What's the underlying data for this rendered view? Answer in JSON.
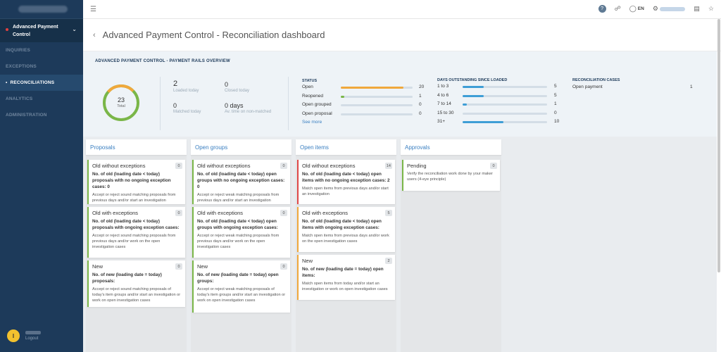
{
  "sidebar": {
    "parent_label": "Advanced Payment Control",
    "items": [
      {
        "label": "INQUIRIES",
        "active": false
      },
      {
        "label": "EXCEPTIONS",
        "active": false
      },
      {
        "label": "RECONCILIATIONS",
        "active": true
      },
      {
        "label": "ANALYTICS",
        "active": false
      },
      {
        "label": "ADMINISTRATION",
        "active": false
      }
    ],
    "avatar_letter": "I",
    "logout_label": "Logout"
  },
  "topbar": {
    "language": "EN"
  },
  "header": {
    "title": "Advanced Payment Control - Reconciliation dashboard"
  },
  "overview": {
    "title": "ADVANCED PAYMENT CONTROL - PAYMENT RAILS OVERVIEW",
    "total_value": "23",
    "total_label": "Total",
    "stats": {
      "loaded_value": "2",
      "loaded_label": "Loaded today",
      "closed_value": "0",
      "closed_label": "Closed today",
      "matched_value": "0",
      "matched_label": "Matched today",
      "avg_value": "0 days",
      "avg_label": "Av. time on non-matched"
    },
    "status": {
      "title": "STATUS",
      "rows": [
        {
          "label": "Open",
          "count": "20",
          "fraction": 0.87,
          "color": "#f0a83c"
        },
        {
          "label": "Reopened",
          "count": "1",
          "fraction": 0.05,
          "color": "#7ab648"
        },
        {
          "label": "Open grouped",
          "count": "0",
          "fraction": 0,
          "color": "#3e9ed6"
        },
        {
          "label": "Open proposal",
          "count": "0",
          "fraction": 0,
          "color": "#3e9ed6"
        }
      ],
      "see_more": "See more"
    },
    "days": {
      "title": "DAYS OUTSTANDING SINCE LOADED",
      "rows": [
        {
          "label": "1 to 3",
          "count": "5",
          "fraction": 0.25
        },
        {
          "label": "4 to 6",
          "count": "5",
          "fraction": 0.25
        },
        {
          "label": "7 to 14",
          "count": "1",
          "fraction": 0.05
        },
        {
          "label": "15 to 30",
          "count": "0",
          "fraction": 0
        },
        {
          "label": "31+",
          "count": "10",
          "fraction": 0.48
        }
      ]
    },
    "reconciliation_cases": {
      "title": "RECONCILIATION CASES",
      "item_label": "Open payment",
      "item_count": "1"
    }
  },
  "columns": [
    {
      "title": "Proposals",
      "cards": [
        {
          "title": "Old without exceptions",
          "badge": "0",
          "sub": "No. of old (loading date < today) proposals with no ongoing exception cases:  0",
          "desc": "Accept or reject sound matching proposals from previous days and/or start an investigation",
          "accent": "green"
        },
        {
          "title": "Old with exceptions",
          "badge": "0",
          "sub": "No. of old (loading date < today) proposals with ongoing exception cases:",
          "desc": "Accept or reject sound matching proposals from previous days and/or work on the open investigation cases",
          "accent": "green"
        },
        {
          "title": "New",
          "badge": "0",
          "sub": "No. of new (loading date = today) proposals:",
          "desc": "Accept or reject sound matching proposals of today's item groups and/or start an investigation or work on open investigation cases",
          "accent": "green"
        }
      ]
    },
    {
      "title": "Open groups",
      "cards": [
        {
          "title": "Old without exceptions",
          "badge": "0",
          "sub": "No. of old (loading date < today) open groups with no ongoing exception cases:  0",
          "desc": "Accept or reject weak matching proposals from previous days and/or start an investigation",
          "accent": "green"
        },
        {
          "title": "Old with exceptions",
          "badge": "0",
          "sub": "No. of old (loading date < today) open groups with ongoing exception cases:",
          "desc": "Accept or reject weak matching proposals from previous days and/or work on the open investigation cases",
          "accent": "green"
        },
        {
          "title": "New",
          "badge": "0",
          "sub": "No. of new (loading date = today) open groups:",
          "desc": "Accept or reject weak matching proposals of today's item groups and/or start an investigation or work on open investigation cases",
          "accent": "green"
        }
      ]
    },
    {
      "title": "Open items",
      "cards": [
        {
          "title": "Old without exceptions",
          "badge": "14",
          "sub": "No. of old (loading date < today) open items with no ongoing exception cases:  2",
          "desc": "Match open items from previous days and/or start an investigation",
          "accent": "red"
        },
        {
          "title": "Old with exceptions",
          "badge": "5",
          "sub": "No. of old (loading date < today) open items with ongoing exception cases:",
          "desc": "Match open items from previous days and/or work on the open investigation cases",
          "accent": "orange"
        },
        {
          "title": "New",
          "badge": "2",
          "sub": "No. of new (loading date = today) open items:",
          "desc": "Match open items from today and/or start an investigation or work on open investigation cases",
          "accent": "orange"
        }
      ]
    },
    {
      "title": "Approvals",
      "cards": [
        {
          "title": "Pending",
          "badge": "0",
          "sub": "",
          "desc": "Verify the reconciliation work done by your maker users (4-eye principle)",
          "accent": "green"
        }
      ]
    }
  ]
}
